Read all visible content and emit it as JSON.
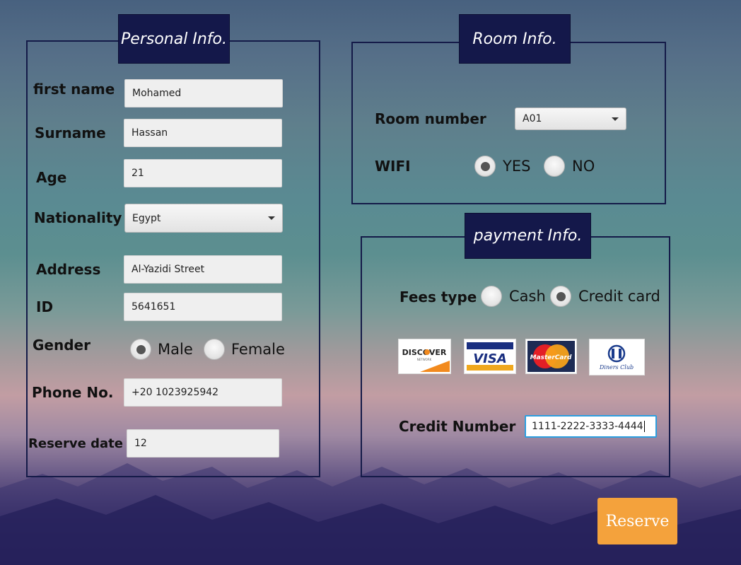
{
  "personal": {
    "title": "Personal Info.",
    "first_name_label": "first name",
    "first_name_value": "Mohamed",
    "surname_label": "Surname",
    "surname_value": "Hassan",
    "age_label": "Age",
    "age_value": "21",
    "nationality_label": "Nationality",
    "nationality_value": "Egypt",
    "address_label": "Address",
    "address_value": "Al-Yazidi Street",
    "id_label": "ID",
    "id_value": "5641651",
    "gender_label": "Gender",
    "gender_options": [
      "Male",
      "Female"
    ],
    "gender_selected": "Male",
    "phone_label": "Phone No.",
    "phone_value": "+20 1023925942",
    "reserve_date_label": "Reserve date",
    "reserve_date_value": "12"
  },
  "room": {
    "title": "Room Info.",
    "room_number_label": "Room number",
    "room_number_value": "A01",
    "wifi_label": "WIFI",
    "wifi_options": [
      "YES",
      "NO"
    ],
    "wifi_selected": "YES"
  },
  "payment": {
    "title": "payment Info.",
    "fees_type_label": "Fees type",
    "fees_options": [
      "Cash",
      "Credit card"
    ],
    "fees_selected": "Credit card",
    "cards": {
      "discover": "DISCOVER",
      "discover_sub": "NETWORK",
      "visa": "VISA",
      "mastercard": "MasterCard",
      "diners": "Diners Club"
    },
    "credit_number_label": "Credit Number",
    "credit_number_value": "1111-2222-3333-4444"
  },
  "actions": {
    "reserve_label": "Reserve"
  },
  "colors": {
    "panel_title_bg": "#14184a",
    "accent_button": "#f4a23c",
    "focus_border": "#2c9fe0"
  }
}
